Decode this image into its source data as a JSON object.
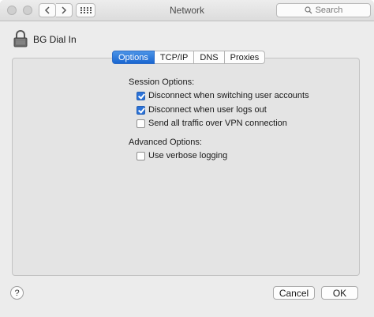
{
  "window": {
    "title": "Network",
    "search_placeholder": "Search",
    "grid_icon": "grid-icon",
    "back_icon": "chevron-left-icon",
    "forward_icon": "chevron-right-icon"
  },
  "connection": {
    "name": "BG Dial In",
    "icon": "lock-icon"
  },
  "tabs": [
    {
      "label": "Options",
      "active": true
    },
    {
      "label": "TCP/IP",
      "active": false
    },
    {
      "label": "DNS",
      "active": false
    },
    {
      "label": "Proxies",
      "active": false
    }
  ],
  "session_options": {
    "heading": "Session Options:",
    "items": [
      {
        "label": "Disconnect when switching user accounts",
        "checked": true
      },
      {
        "label": "Disconnect when user logs out",
        "checked": true
      },
      {
        "label": "Send all traffic over VPN connection",
        "checked": false
      }
    ]
  },
  "advanced_options": {
    "heading": "Advanced Options:",
    "items": [
      {
        "label": "Use verbose logging",
        "checked": false
      }
    ]
  },
  "footer": {
    "help_label": "?",
    "cancel_label": "Cancel",
    "ok_label": "OK"
  }
}
